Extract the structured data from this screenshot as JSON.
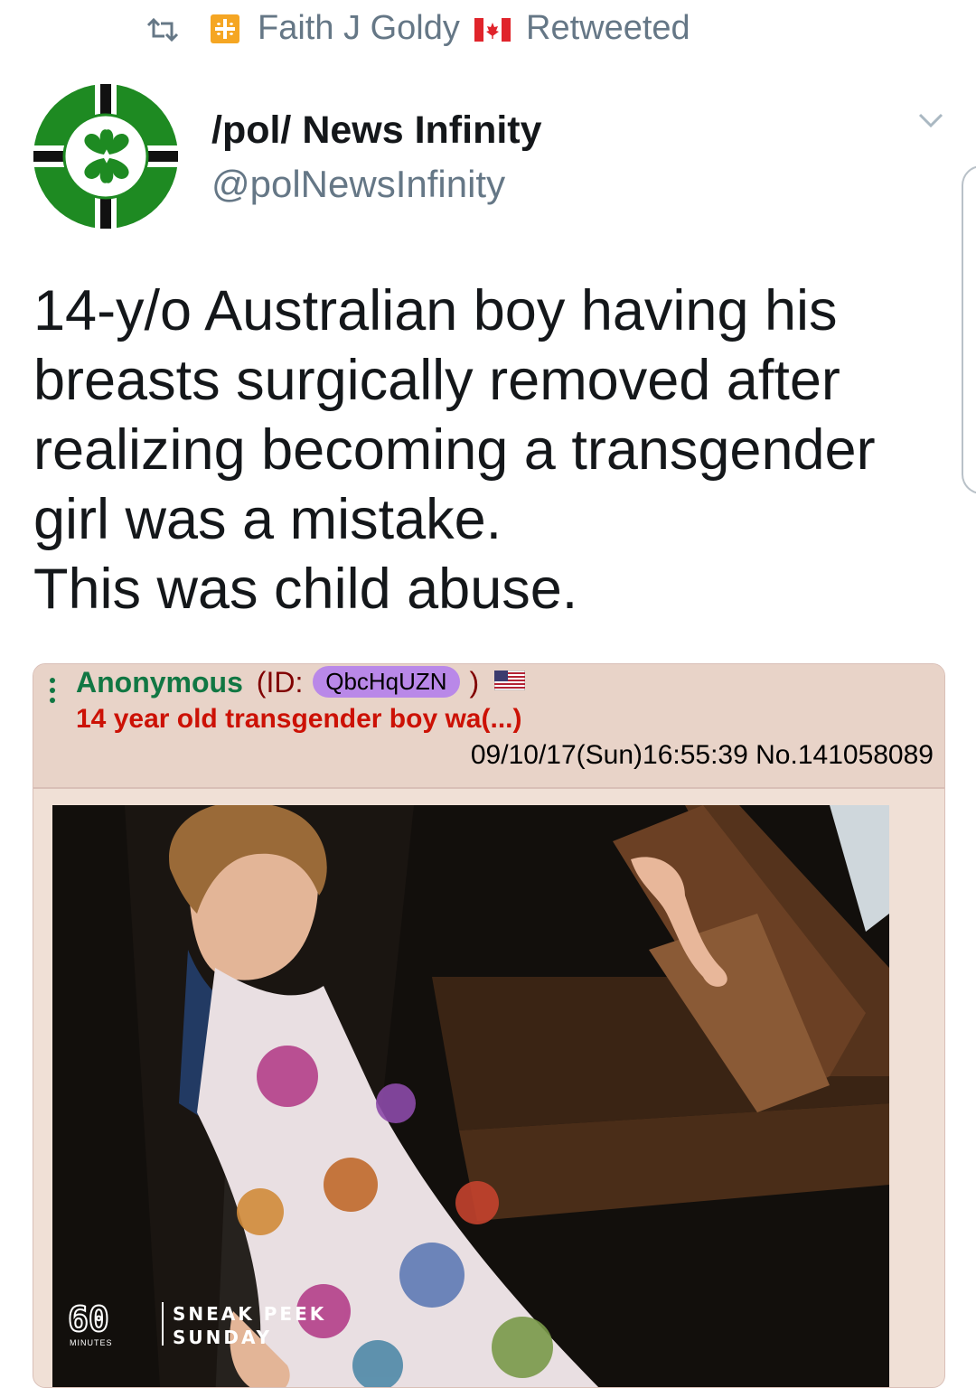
{
  "retweet": {
    "retweeter": "Faith J Goldy",
    "label": "Retweeted"
  },
  "author": {
    "name": "/pol/ News Infinity",
    "handle": "@polNewsInfinity"
  },
  "tweet": {
    "lines": [
      "14-y/o Australian boy having his breasts surgically removed after realizing becoming a transgender girl was a mistake.",
      "This was child abuse."
    ]
  },
  "post": {
    "name": "Anonymous",
    "id_prefix": "(ID:",
    "id": "QbcHqUZN",
    "id_suffix": ")",
    "subject": "14 year old transgender boy wa(...)",
    "datetime": "09/10/17(Sun)16:55:39",
    "number": "No.141058089"
  },
  "watermark": {
    "logo": "60",
    "logo_sub": "MINUTES",
    "line1": "SNEAK PEEK",
    "line2": "SUNDAY"
  },
  "colors": {
    "post_name": "#117743",
    "post_subject": "#cc1105",
    "post_bg": "#f0e0d6",
    "id_pill": "#b988e8",
    "muted": "#657786"
  },
  "icons": [
    "retweet-icon",
    "canadian-flag-icon",
    "chevron-down-icon",
    "kebab-menu-icon",
    "us-flag-icon"
  ]
}
